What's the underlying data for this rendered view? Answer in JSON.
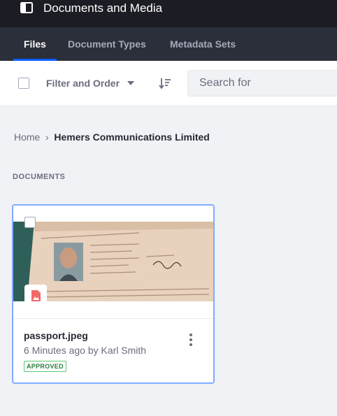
{
  "header": {
    "title": "Documents and Media",
    "panel_icon": "product-menu-icon"
  },
  "nav": {
    "tabs": [
      {
        "label": "Files",
        "active": true
      },
      {
        "label": "Document Types",
        "active": false
      },
      {
        "label": "Metadata Sets",
        "active": false
      }
    ]
  },
  "toolbar": {
    "filter_label": "Filter and Order",
    "search_placeholder": "Search for",
    "sort_icon": "order-arrow-icon"
  },
  "breadcrumb": {
    "home": "Home",
    "current": "Hemers Communications Limited"
  },
  "documents": {
    "section_title": "DOCUMENTS",
    "items": [
      {
        "title": "passport.jpeg",
        "subtitle": "6 Minutes ago by Karl Smith",
        "status": "APPROVED",
        "file_type_icon": "document-image-icon"
      }
    ]
  },
  "colors": {
    "accent": "#0b5fff",
    "topbar": "#1c1c24",
    "navbar": "#2b2f3a",
    "approved": "#287d3c",
    "image_sticker": "#f26969"
  }
}
